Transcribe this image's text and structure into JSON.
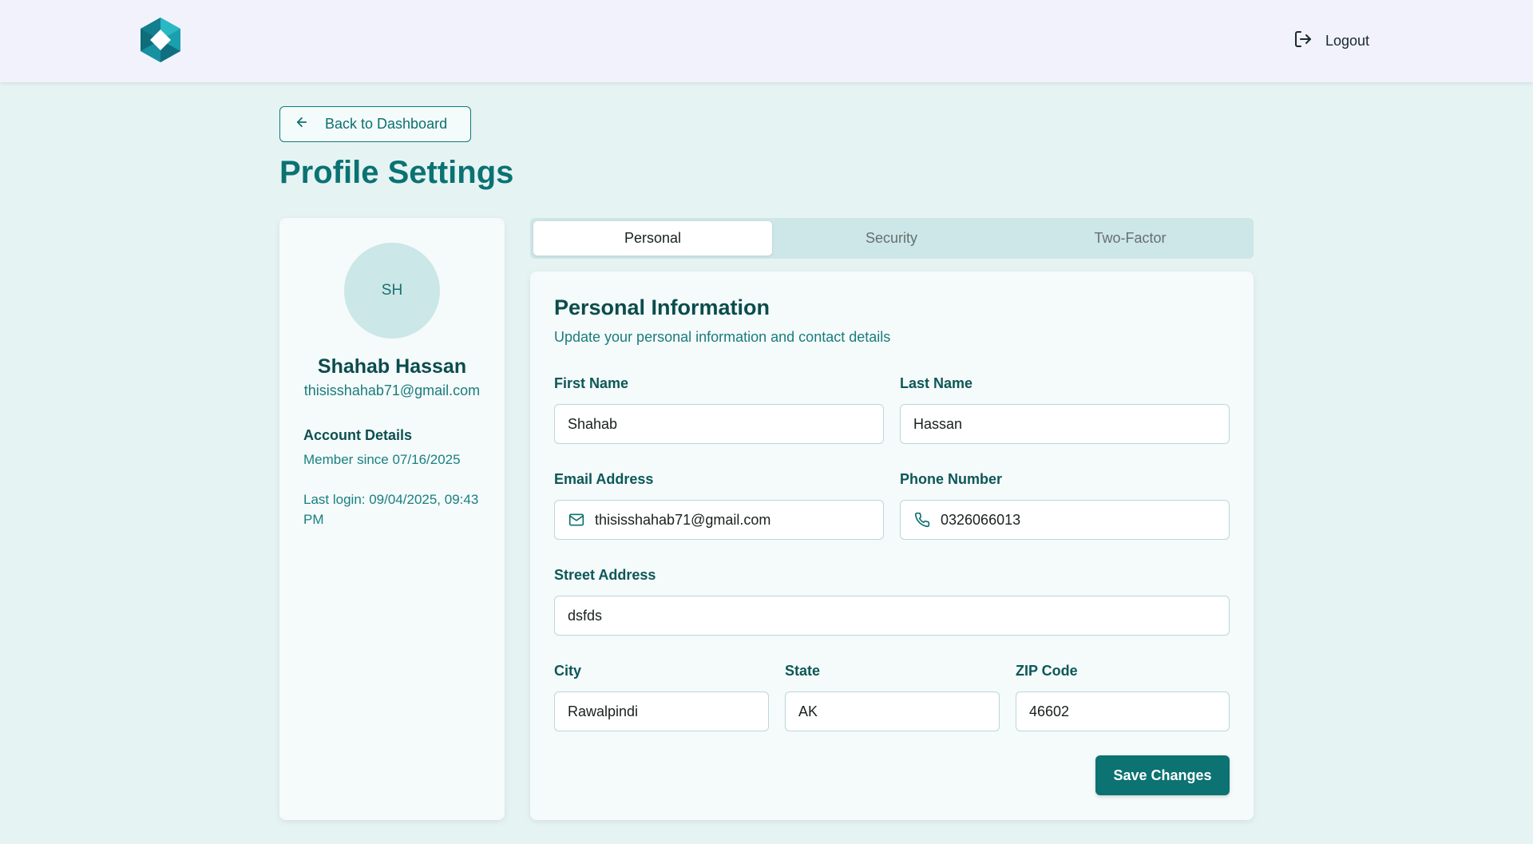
{
  "header": {
    "logo_icon": "hexagon-logo-icon",
    "logout_label": "Logout",
    "logout_icon": "logout-icon"
  },
  "back_button": {
    "label": "Back to Dashboard",
    "icon": "arrow-left-icon"
  },
  "page_title": "Profile Settings",
  "profile": {
    "initials": "SH",
    "name": "Shahab Hassan",
    "email": "thisisshahab71@gmail.com",
    "account_heading": "Account Details",
    "member_since": "Member since 07/16/2025",
    "last_login": "Last login: 09/04/2025, 09:43 PM"
  },
  "tabs": [
    {
      "label": "Personal",
      "active": true
    },
    {
      "label": "Security",
      "active": false
    },
    {
      "label": "Two-Factor",
      "active": false
    }
  ],
  "form": {
    "title": "Personal Information",
    "subtitle": "Update your personal information and contact details",
    "first_name": {
      "label": "First Name",
      "value": "Shahab"
    },
    "last_name": {
      "label": "Last Name",
      "value": "Hassan"
    },
    "email": {
      "label": "Email Address",
      "value": "thisisshahab71@gmail.com",
      "icon": "mail-icon"
    },
    "phone": {
      "label": "Phone Number",
      "value": "0326066013",
      "icon": "phone-icon"
    },
    "street": {
      "label": "Street Address",
      "value": "dsfds"
    },
    "city": {
      "label": "City",
      "value": "Rawalpindi"
    },
    "state": {
      "label": "State",
      "value": "AK"
    },
    "zip": {
      "label": "ZIP Code",
      "value": "46602"
    },
    "save_label": "Save Changes"
  },
  "colors": {
    "accent": "#0c7272",
    "background": "#e6f3f3",
    "header_bg": "#f1f2fb"
  }
}
